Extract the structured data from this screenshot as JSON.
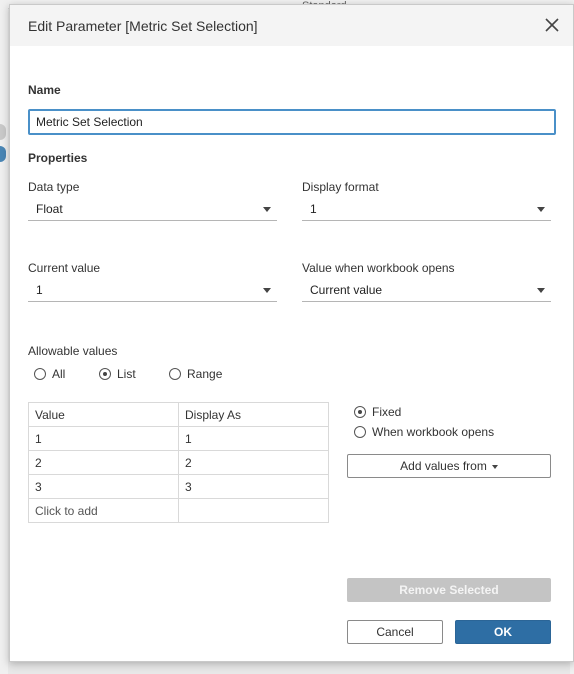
{
  "background": {
    "toolbar_text": "Standard"
  },
  "dialog": {
    "title": "Edit Parameter [Metric Set Selection]",
    "name_heading": "Name",
    "name_value": "Metric Set Selection",
    "properties_heading": "Properties",
    "data_type": {
      "label": "Data type",
      "value": "Float"
    },
    "display_format": {
      "label": "Display format",
      "value": "1"
    },
    "current_value": {
      "label": "Current value",
      "value": "1"
    },
    "value_when_opens": {
      "label": "Value when workbook opens",
      "value": "Current value"
    },
    "allowable": {
      "label": "Allowable values",
      "options": [
        "All",
        "List",
        "Range"
      ],
      "selected": "List"
    },
    "table": {
      "headers": [
        "Value",
        "Display As"
      ],
      "rows": [
        [
          "1",
          "1"
        ],
        [
          "2",
          "2"
        ],
        [
          "3",
          "3"
        ]
      ],
      "add_row_text": "Click to add"
    },
    "source_options": {
      "options": [
        "Fixed",
        "When workbook opens"
      ],
      "selected": "Fixed"
    },
    "add_values_label": "Add values from",
    "remove_selected_label": "Remove Selected",
    "cancel_label": "Cancel",
    "ok_label": "OK"
  },
  "colors": {
    "primary": "#2e6ea4",
    "focus_border": "#4a90c8",
    "disabled": "#c4c4c4"
  }
}
